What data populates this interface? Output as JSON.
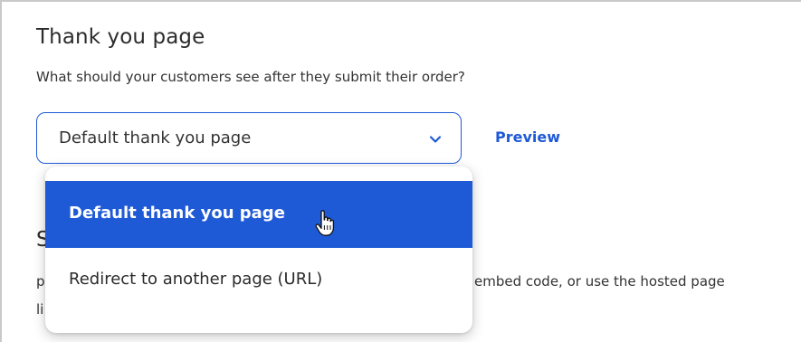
{
  "thank_you": {
    "title": "Thank you page",
    "subtitle": "What should your customers see after they submit their order?",
    "select": {
      "value": "Default thank you page"
    },
    "preview_label": "Preview"
  },
  "dropdown": {
    "options": [
      {
        "label": "Default thank you page",
        "selected": true
      },
      {
        "label": "Redirect to another page (URL)",
        "selected": false
      }
    ]
  },
  "background_section": {
    "heading_visible": "S",
    "line1_left": "p",
    "line1_right": "embed code, or use the hosted page",
    "line2_left": "li",
    "line2_right": ""
  },
  "icons": {
    "select_chevron": "chevron-down-icon",
    "cursor": "hand-pointer-icon"
  },
  "colors": {
    "accent": "#1f5ad6",
    "text": "#2b2b2b",
    "selected_text": "#ffffff"
  }
}
